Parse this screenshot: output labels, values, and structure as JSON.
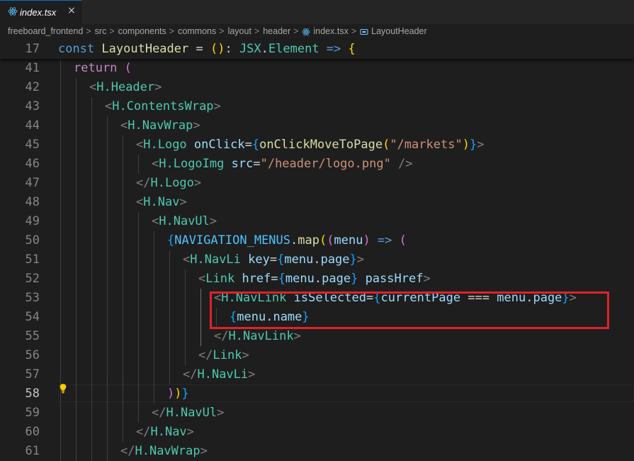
{
  "tab": {
    "filename": "index.tsx",
    "close_glyph": "×",
    "icon": "react-icon"
  },
  "breadcrumb": {
    "items": [
      "freeboard_frontend",
      "src",
      "components",
      "commons",
      "layout",
      "header",
      "index.tsx",
      "LayoutHeader"
    ],
    "separator": ">",
    "file_icon": "react-icon",
    "symbol_icon": "symbol-component-icon"
  },
  "editor": {
    "current_line": "58",
    "lightbulb_icon": "lightbulb-icon",
    "sticky": {
      "number": "17",
      "tokens": [
        {
          "t": "const ",
          "c": "kw"
        },
        {
          "t": "LayoutHeader",
          "c": "fn"
        },
        {
          "t": " = ",
          "c": "op"
        },
        {
          "t": "()",
          "c": "b1"
        },
        {
          "t": ": ",
          "c": "op"
        },
        {
          "t": "JSX",
          "c": "tag"
        },
        {
          "t": ".",
          "c": "op"
        },
        {
          "t": "Element",
          "c": "tag"
        },
        {
          "t": " => ",
          "c": "kw"
        },
        {
          "t": "{",
          "c": "b1"
        }
      ]
    },
    "lines": [
      {
        "number": "41",
        "indent": 1,
        "tokens": [
          {
            "t": "return ",
            "c": "kwc"
          },
          {
            "t": "(",
            "c": "b2"
          }
        ]
      },
      {
        "number": "42",
        "indent": 2,
        "tokens": [
          {
            "t": "<",
            "c": "br"
          },
          {
            "t": "H.Header",
            "c": "tag"
          },
          {
            "t": ">",
            "c": "br"
          }
        ]
      },
      {
        "number": "43",
        "indent": 3,
        "tokens": [
          {
            "t": "<",
            "c": "br"
          },
          {
            "t": "H.ContentsWrap",
            "c": "tag"
          },
          {
            "t": ">",
            "c": "br"
          }
        ]
      },
      {
        "number": "44",
        "indent": 4,
        "tokens": [
          {
            "t": "<",
            "c": "br"
          },
          {
            "t": "H.NavWrap",
            "c": "tag"
          },
          {
            "t": ">",
            "c": "br"
          }
        ]
      },
      {
        "number": "45",
        "indent": 5,
        "tokens": [
          {
            "t": "<",
            "c": "br"
          },
          {
            "t": "H.Logo",
            "c": "tag"
          },
          {
            "t": " ",
            "c": "op"
          },
          {
            "t": "onClick",
            "c": "attr"
          },
          {
            "t": "=",
            "c": "op"
          },
          {
            "t": "{",
            "c": "b3"
          },
          {
            "t": "onClickMoveToPage",
            "c": "fn"
          },
          {
            "t": "(",
            "c": "b1"
          },
          {
            "t": "\"/markets\"",
            "c": "str"
          },
          {
            "t": ")",
            "c": "b1"
          },
          {
            "t": "}",
            "c": "b3"
          },
          {
            "t": ">",
            "c": "br"
          }
        ]
      },
      {
        "number": "46",
        "indent": 6,
        "tokens": [
          {
            "t": "<",
            "c": "br"
          },
          {
            "t": "H.LogoImg",
            "c": "tag"
          },
          {
            "t": " ",
            "c": "op"
          },
          {
            "t": "src",
            "c": "attr"
          },
          {
            "t": "=",
            "c": "op"
          },
          {
            "t": "\"/header/logo.png\"",
            "c": "str"
          },
          {
            "t": " />",
            "c": "br"
          }
        ]
      },
      {
        "number": "47",
        "indent": 5,
        "tokens": [
          {
            "t": "</",
            "c": "br"
          },
          {
            "t": "H.Logo",
            "c": "tag"
          },
          {
            "t": ">",
            "c": "br"
          }
        ]
      },
      {
        "number": "48",
        "indent": 5,
        "tokens": [
          {
            "t": "<",
            "c": "br"
          },
          {
            "t": "H.Nav",
            "c": "tag"
          },
          {
            "t": ">",
            "c": "br"
          }
        ]
      },
      {
        "number": "49",
        "indent": 6,
        "tokens": [
          {
            "t": "<",
            "c": "br"
          },
          {
            "t": "H.NavUl",
            "c": "tag"
          },
          {
            "t": ">",
            "c": "br"
          }
        ]
      },
      {
        "number": "50",
        "indent": 7,
        "tokens": [
          {
            "t": "{",
            "c": "b3"
          },
          {
            "t": "NAVIGATION_MENUS",
            "c": "cst"
          },
          {
            "t": ".",
            "c": "op"
          },
          {
            "t": "map",
            "c": "fn"
          },
          {
            "t": "(",
            "c": "b1"
          },
          {
            "t": "(",
            "c": "b2"
          },
          {
            "t": "menu",
            "c": "var"
          },
          {
            "t": ")",
            "c": "b2"
          },
          {
            "t": " => ",
            "c": "kw"
          },
          {
            "t": "(",
            "c": "b2"
          }
        ]
      },
      {
        "number": "51",
        "indent": 8,
        "tokens": [
          {
            "t": "<",
            "c": "br"
          },
          {
            "t": "H.NavLi",
            "c": "tag"
          },
          {
            "t": " ",
            "c": "op"
          },
          {
            "t": "key",
            "c": "attr"
          },
          {
            "t": "=",
            "c": "op"
          },
          {
            "t": "{",
            "c": "b3"
          },
          {
            "t": "menu",
            "c": "var"
          },
          {
            "t": ".",
            "c": "op"
          },
          {
            "t": "page",
            "c": "var"
          },
          {
            "t": "}",
            "c": "b3"
          },
          {
            "t": ">",
            "c": "br"
          }
        ]
      },
      {
        "number": "52",
        "indent": 9,
        "tokens": [
          {
            "t": "<",
            "c": "br"
          },
          {
            "t": "Link",
            "c": "tag"
          },
          {
            "t": " ",
            "c": "op"
          },
          {
            "t": "href",
            "c": "attr"
          },
          {
            "t": "=",
            "c": "op"
          },
          {
            "t": "{",
            "c": "b3"
          },
          {
            "t": "menu",
            "c": "var"
          },
          {
            "t": ".",
            "c": "op"
          },
          {
            "t": "page",
            "c": "var"
          },
          {
            "t": "}",
            "c": "b3"
          },
          {
            "t": " ",
            "c": "op"
          },
          {
            "t": "passHref",
            "c": "attr"
          },
          {
            "t": ">",
            "c": "br"
          }
        ]
      },
      {
        "number": "53",
        "indent": 10,
        "tokens": [
          {
            "t": "<",
            "c": "br"
          },
          {
            "t": "H.NavLink",
            "c": "tag"
          },
          {
            "t": " ",
            "c": "op"
          },
          {
            "t": "isSelected",
            "c": "attr"
          },
          {
            "t": "=",
            "c": "op"
          },
          {
            "t": "{",
            "c": "b3"
          },
          {
            "t": "currentPage",
            "c": "var"
          },
          {
            "t": " === ",
            "c": "op"
          },
          {
            "t": "menu",
            "c": "var"
          },
          {
            "t": ".",
            "c": "op"
          },
          {
            "t": "page",
            "c": "var"
          },
          {
            "t": "}",
            "c": "b3"
          },
          {
            "t": ">",
            "c": "br"
          }
        ]
      },
      {
        "number": "54",
        "indent": 11,
        "tokens": [
          {
            "t": "{",
            "c": "b3"
          },
          {
            "t": "menu",
            "c": "var"
          },
          {
            "t": ".",
            "c": "op"
          },
          {
            "t": "name",
            "c": "var"
          },
          {
            "t": "}",
            "c": "b3"
          }
        ]
      },
      {
        "number": "55",
        "indent": 10,
        "tokens": [
          {
            "t": "</",
            "c": "br"
          },
          {
            "t": "H.NavLink",
            "c": "tag"
          },
          {
            "t": ">",
            "c": "br"
          }
        ]
      },
      {
        "number": "56",
        "indent": 9,
        "tokens": [
          {
            "t": "</",
            "c": "br"
          },
          {
            "t": "Link",
            "c": "tag"
          },
          {
            "t": ">",
            "c": "br"
          }
        ]
      },
      {
        "number": "57",
        "indent": 8,
        "tokens": [
          {
            "t": "</",
            "c": "br"
          },
          {
            "t": "H.NavLi",
            "c": "tag"
          },
          {
            "t": ">",
            "c": "br"
          }
        ]
      },
      {
        "number": "58",
        "indent": 7,
        "tokens": [
          {
            "t": ")",
            "c": "b2"
          },
          {
            "t": ")",
            "c": "b1"
          },
          {
            "t": "}",
            "c": "b3"
          }
        ]
      },
      {
        "number": "59",
        "indent": 6,
        "tokens": [
          {
            "t": "</",
            "c": "br"
          },
          {
            "t": "H.NavUl",
            "c": "tag"
          },
          {
            "t": ">",
            "c": "br"
          }
        ]
      },
      {
        "number": "60",
        "indent": 5,
        "tokens": [
          {
            "t": "</",
            "c": "br"
          },
          {
            "t": "H.Nav",
            "c": "tag"
          },
          {
            "t": ">",
            "c": "br"
          }
        ]
      },
      {
        "number": "61",
        "indent": 4,
        "tokens": [
          {
            "t": "</",
            "c": "br"
          },
          {
            "t": "H.NavWrap",
            "c": "tag"
          },
          {
            "t": ">",
            "c": "br"
          }
        ]
      }
    ]
  }
}
